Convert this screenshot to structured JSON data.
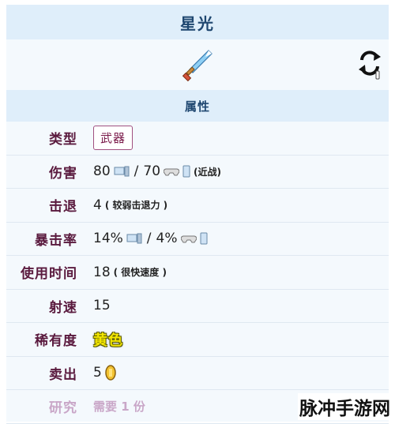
{
  "header": {
    "title": "星光"
  },
  "section": {
    "title": "属性"
  },
  "rows": {
    "type": {
      "label": "类型",
      "value": "武器"
    },
    "damage": {
      "label": "伤害",
      "desktop_value": "80",
      "sep": "/",
      "console_value": "70",
      "note": "(近战)"
    },
    "knockback": {
      "label": "击退",
      "value": "4",
      "note": "( 较弱击退力 )"
    },
    "crit": {
      "label": "暴击率",
      "desktop_value": "14%",
      "sep": "/",
      "console_value": "4%"
    },
    "use_time": {
      "label": "使用时间",
      "value": "18",
      "note": "( 很快速度 )"
    },
    "velocity": {
      "label": "射速",
      "value": "15"
    },
    "rarity": {
      "label": "稀有度",
      "value": "黄色",
      "color": "#f3e600"
    },
    "sell": {
      "label": "卖出",
      "value": "5"
    },
    "research": {
      "label": "研究",
      "value": "需要 1 份"
    }
  },
  "icons": [
    "sword-icon",
    "refresh-icon",
    "desktop-icon",
    "gamepad-icon",
    "mobile-icon",
    "gold-coin-icon"
  ],
  "watermark": "脉冲手游网",
  "colors": {
    "header_bg": "#dfeefa",
    "label": "#5a1a3e",
    "title": "#1f4770"
  }
}
